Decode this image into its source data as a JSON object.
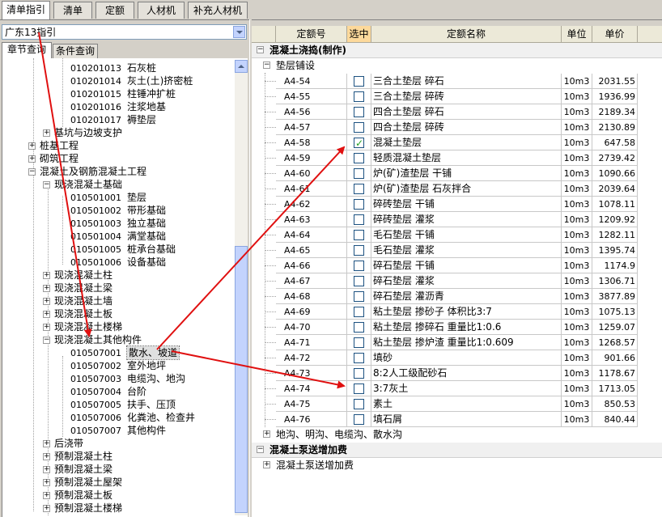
{
  "top_tabs": [
    "清单指引",
    "清单",
    "定额",
    "人材机",
    "补充人材机"
  ],
  "left": {
    "combo_value": "广东13指引",
    "tabs": [
      "章节查询",
      "条件查询"
    ],
    "tree": [
      {
        "code": "010201013",
        "name": "石灰桩"
      },
      {
        "code": "010201014",
        "name": "灰土(土)挤密桩"
      },
      {
        "code": "010201015",
        "name": "柱锤冲扩桩"
      },
      {
        "code": "010201016",
        "name": "注浆地基"
      },
      {
        "code": "010201017",
        "name": "褥垫层"
      },
      {
        "code": "",
        "name": "基坑与边坡支护"
      },
      {
        "code": "",
        "name": "桩基工程"
      },
      {
        "code": "",
        "name": "砌筑工程"
      },
      {
        "code": "",
        "name": "混凝土及钢筋混凝土工程"
      },
      {
        "code": "",
        "name": "现浇混凝土基础"
      },
      {
        "code": "010501001",
        "name": "垫层"
      },
      {
        "code": "010501002",
        "name": "带形基础"
      },
      {
        "code": "010501003",
        "name": "独立基础"
      },
      {
        "code": "010501004",
        "name": "满堂基础"
      },
      {
        "code": "010501005",
        "name": "桩承台基础"
      },
      {
        "code": "010501006",
        "name": "设备基础"
      },
      {
        "code": "",
        "name": "现浇混凝土柱"
      },
      {
        "code": "",
        "name": "现浇混凝土梁"
      },
      {
        "code": "",
        "name": "现浇混凝土墙"
      },
      {
        "code": "",
        "name": "现浇混凝土板"
      },
      {
        "code": "",
        "name": "现浇混凝土楼梯"
      },
      {
        "code": "",
        "name": "现浇混凝土其他构件"
      },
      {
        "code": "010507001",
        "name": "散水、坡道"
      },
      {
        "code": "010507002",
        "name": "室外地坪"
      },
      {
        "code": "010507003",
        "name": "电缆沟、地沟"
      },
      {
        "code": "010507004",
        "name": "台阶"
      },
      {
        "code": "010507005",
        "name": "扶手、压顶"
      },
      {
        "code": "010507006",
        "name": "化粪池、检查井"
      },
      {
        "code": "010507007",
        "name": "其他构件"
      },
      {
        "code": "",
        "name": "后浇带"
      },
      {
        "code": "",
        "name": "预制混凝土柱"
      },
      {
        "code": "",
        "name": "预制混凝土梁"
      },
      {
        "code": "",
        "name": "预制混凝土屋架"
      },
      {
        "code": "",
        "name": "预制混凝土板"
      },
      {
        "code": "",
        "name": "预制混凝土楼梯"
      }
    ]
  },
  "grid": {
    "headers": [
      "定额号",
      "选中",
      "定额名称",
      "单位",
      "单价"
    ],
    "group1": "混凝土浇捣(制作)",
    "subgroup1": "垫层铺设",
    "rows": [
      {
        "code": "A4-54",
        "checked": false,
        "name": "三合土垫层 碎石",
        "unit": "10m3",
        "price": "2031.55"
      },
      {
        "code": "A4-55",
        "checked": false,
        "name": "三合土垫层 碎砖",
        "unit": "10m3",
        "price": "1936.99"
      },
      {
        "code": "A4-56",
        "checked": false,
        "name": "四合土垫层 碎石",
        "unit": "10m3",
        "price": "2189.34"
      },
      {
        "code": "A4-57",
        "checked": false,
        "name": "四合土垫层 碎砖",
        "unit": "10m3",
        "price": "2130.89"
      },
      {
        "code": "A4-58",
        "checked": true,
        "name": "混凝土垫层",
        "unit": "10m3",
        "price": "647.58"
      },
      {
        "code": "A4-59",
        "checked": false,
        "name": "轻质混凝土垫层",
        "unit": "10m3",
        "price": "2739.42"
      },
      {
        "code": "A4-60",
        "checked": false,
        "name": "炉(矿)渣垫层 干铺",
        "unit": "10m3",
        "price": "1090.66"
      },
      {
        "code": "A4-61",
        "checked": false,
        "name": "炉(矿)渣垫层 石灰拌合",
        "unit": "10m3",
        "price": "2039.64"
      },
      {
        "code": "A4-62",
        "checked": false,
        "name": "碎砖垫层 干铺",
        "unit": "10m3",
        "price": "1078.11"
      },
      {
        "code": "A4-63",
        "checked": false,
        "name": "碎砖垫层 灌浆",
        "unit": "10m3",
        "price": "1209.92"
      },
      {
        "code": "A4-64",
        "checked": false,
        "name": "毛石垫层 干铺",
        "unit": "10m3",
        "price": "1282.11"
      },
      {
        "code": "A4-65",
        "checked": false,
        "name": "毛石垫层 灌浆",
        "unit": "10m3",
        "price": "1395.74"
      },
      {
        "code": "A4-66",
        "checked": false,
        "name": "碎石垫层 干铺",
        "unit": "10m3",
        "price": "1174.9"
      },
      {
        "code": "A4-67",
        "checked": false,
        "name": "碎石垫层 灌浆",
        "unit": "10m3",
        "price": "1306.71"
      },
      {
        "code": "A4-68",
        "checked": false,
        "name": "碎石垫层 灌沥青",
        "unit": "10m3",
        "price": "3877.89"
      },
      {
        "code": "A4-69",
        "checked": false,
        "name": "粘土垫层 掺砂子 体积比3:7",
        "unit": "10m3",
        "price": "1075.13"
      },
      {
        "code": "A4-70",
        "checked": false,
        "name": "粘土垫层 掺碎石 重量比1:0.6",
        "unit": "10m3",
        "price": "1259.07"
      },
      {
        "code": "A4-71",
        "checked": false,
        "name": "粘土垫层 掺炉渣 重量比1:0.609",
        "unit": "10m3",
        "price": "1268.57"
      },
      {
        "code": "A4-72",
        "checked": false,
        "name": "填砂",
        "unit": "10m3",
        "price": "901.66"
      },
      {
        "code": "A4-73",
        "checked": false,
        "name": "8:2人工级配砂石",
        "unit": "10m3",
        "price": "1178.67"
      },
      {
        "code": "A4-74",
        "checked": false,
        "name": "3:7灰土",
        "unit": "10m3",
        "price": "1713.05"
      },
      {
        "code": "A4-75",
        "checked": false,
        "name": "素土",
        "unit": "10m3",
        "price": "850.53"
      },
      {
        "code": "A4-76",
        "checked": false,
        "name": "填石屑",
        "unit": "10m3",
        "price": "840.44"
      }
    ],
    "subgroup2": "地沟、明沟、电缆沟、散水沟",
    "group2": "混凝土泵送增加费",
    "subgroup3": "混凝土泵送增加费"
  },
  "colors": {
    "arrow": "#e01010",
    "selected_header": "#fdd99b",
    "check": "#21a121"
  }
}
